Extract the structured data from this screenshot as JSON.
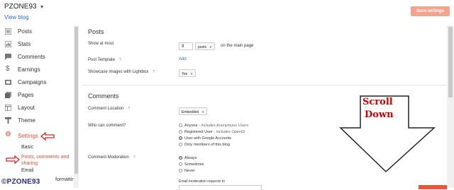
{
  "header": {
    "blog_name": "PZONE93",
    "view_blog": "View blog",
    "save_label": "Save settings"
  },
  "sidebar": {
    "items": [
      {
        "label": "Posts",
        "icon": "posts-icon"
      },
      {
        "label": "Stats",
        "icon": "stats-icon"
      },
      {
        "label": "Comments",
        "icon": "comments-icon"
      },
      {
        "label": "Earnings",
        "icon": "dollar-icon"
      },
      {
        "label": "Campaigns",
        "icon": "campaigns-icon"
      },
      {
        "label": "Pages",
        "icon": "pages-icon"
      },
      {
        "label": "Layout",
        "icon": "layout-icon"
      },
      {
        "label": "Theme",
        "icon": "theme-icon"
      },
      {
        "label": "Settings",
        "icon": "gear-icon",
        "active": true
      }
    ],
    "sub_items": [
      {
        "label": "Basic"
      },
      {
        "label": "Posts, comments and sharing",
        "active": true
      },
      {
        "label": "Email"
      },
      {
        "label": "formatting"
      }
    ]
  },
  "watermark": "©PZONE93",
  "posts_section": {
    "title": "Posts",
    "show_at_most_label": "Show at most",
    "show_at_most_value": "9",
    "show_unit": "posts",
    "show_suffix": "on the main page",
    "post_template_label": "Post Template",
    "post_template_action": "Add",
    "lightbox_label": "Showcase images with Lightbox",
    "lightbox_value": "Yes"
  },
  "comments_section": {
    "title": "Comments",
    "location_label": "Comment Location",
    "location_value": "Embedded",
    "who_label": "Who can comment?",
    "who_options": [
      {
        "label": "Anyone",
        "note": "- includes Anonymous Users",
        "selected": false
      },
      {
        "label": "Registered User",
        "note": "- includes OpenID",
        "selected": false
      },
      {
        "label": "User with Google Accounts",
        "note": "",
        "selected": true
      },
      {
        "label": "Only members of this blog",
        "note": "",
        "selected": false
      }
    ],
    "moderation_label": "Comment Moderation",
    "moderation_options": [
      {
        "label": "Always",
        "selected": true
      },
      {
        "label": "Sometimes",
        "selected": false
      },
      {
        "label": "Never",
        "selected": false
      }
    ],
    "email_moderation_note": "Email moderation requests to"
  },
  "annotation": {
    "scroll_word1": "Scroll",
    "scroll_word2": "Down"
  },
  "colors": {
    "accent_red": "#dd4b39",
    "link_blue": "#2b6bd6",
    "save_button": "#f4a48e",
    "annotation_red": "#cc0000"
  }
}
